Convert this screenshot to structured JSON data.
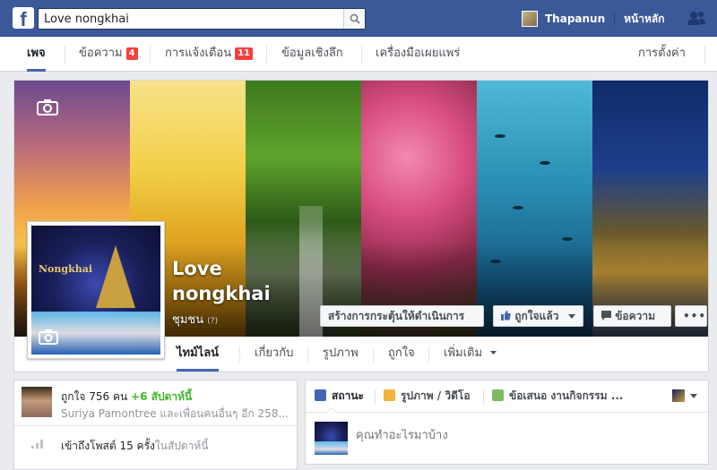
{
  "topbar": {
    "search_value": "Love nongkhai",
    "user_name": "Thapanun",
    "home_label": "หน้าหลัก"
  },
  "page_tabs": {
    "page": "เพจ",
    "messages": "ข้อความ",
    "messages_count": "4",
    "notifications": "การแจ้งเตือน",
    "notifications_count": "11",
    "insights": "ข้อมูลเชิงลึก",
    "publishing_tools": "เครื่องมือเผยแพร่",
    "settings": "การตั้งค่า"
  },
  "cover": {
    "title": "Love nongkhai",
    "category": "ชุมชน",
    "category_hint": "(?)",
    "cta_button": "สร้างการกระตุ้นให้ดำเนินการ",
    "liked_button": "ถูกใจแล้ว",
    "message_button": "ข้อความ",
    "more_button": "•••"
  },
  "profile": {
    "logo_text": "Nongkhai"
  },
  "timeline_tabs": [
    "ไทม์ไลน์",
    "เกี่ยวกับ",
    "รูปภาพ",
    "ถูกใจ",
    "เพิ่มเติม"
  ],
  "stats": {
    "likes_text": "ถูกใจ 756 คน",
    "likes_this_week": "+6 สัปดาห์นี้",
    "friends_text": "Suriya Pamontree และเพื่อนคนอื่นๆ อีก 258...",
    "reach_text": "เข้าถึงโพสต์ 15 ครั้ง",
    "reach_period": "ในสัปดาห์นี้"
  },
  "composer": {
    "tabs": [
      "สถานะ",
      "รูปภาพ / วิดีโอ",
      "ข้อเสนอ งานกิจกรรม ..."
    ],
    "placeholder": "คุณทำอะไรมาบ้าง"
  },
  "colors": {
    "brand_blue": "#3b5998",
    "badge_red": "#fa3e3e",
    "growth_green": "#42b72a",
    "active_tab_underline": "#4267b2"
  },
  "icons": [
    "facebook-logo",
    "search-icon",
    "friends-icon",
    "camera-icon",
    "thumbs-up-icon",
    "message-icon",
    "reach-bars-icon",
    "pencil-icon",
    "photo-icon",
    "offer-icon",
    "dropdown-caret-icon"
  ]
}
